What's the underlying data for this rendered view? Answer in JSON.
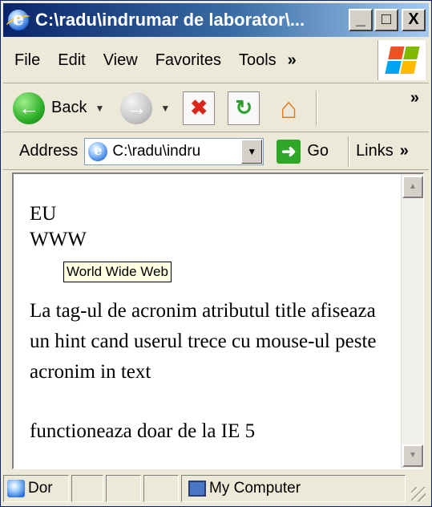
{
  "window": {
    "title": "C:\\radu\\indrumar de laborator\\...",
    "caption_buttons": {
      "minimize": "_",
      "maximize": "□",
      "close": "X"
    }
  },
  "menubar": {
    "items": [
      {
        "label": "File",
        "icon": ""
      },
      {
        "label": "Edit"
      },
      {
        "label": "View"
      },
      {
        "label": "Favorites"
      },
      {
        "label": "Tools"
      }
    ],
    "overflow": "»"
  },
  "toolbar": {
    "back_label": "Back",
    "overflow": "»",
    "icons": [
      "back-icon",
      "forward-icon",
      "stop-icon",
      "refresh-icon",
      "home-icon"
    ]
  },
  "addressbar": {
    "label": "Address",
    "value": "C:\\radu\\indru",
    "go_label": "Go",
    "links_label": "Links",
    "overflow": "»"
  },
  "content": {
    "line1": "EU",
    "acronym": "WWW",
    "tooltip": "World Wide Web",
    "paragraph": "La tag-ul de acronim atributul title afiseaza un hint cand userul trece cu mouse-ul peste acronim in text",
    "note": "functioneaza doar de la IE 5"
  },
  "statusbar": {
    "status_text": "Dor",
    "zone_text": "My Computer"
  },
  "colors": {
    "titlebar_start": "#0a246a",
    "titlebar_end": "#a6caf0",
    "chrome": "#ece9d8",
    "tooltip_bg": "#ffffe1"
  }
}
